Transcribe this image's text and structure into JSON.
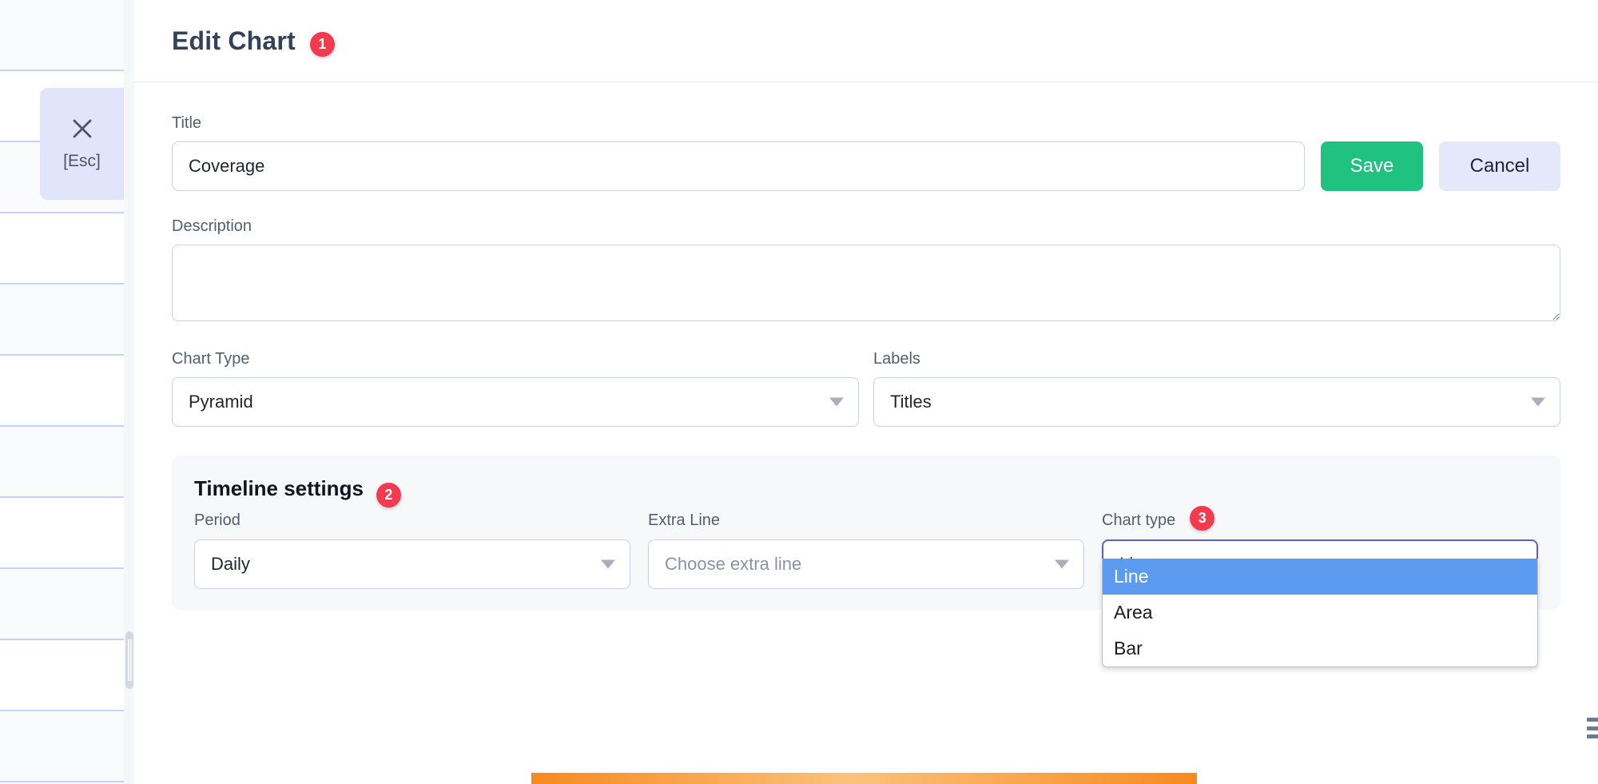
{
  "close_button": {
    "icon": "close-icon",
    "label": "[Esc]"
  },
  "modal": {
    "title": "Edit Chart",
    "badge_1": "1"
  },
  "form": {
    "title_label": "Title",
    "title_value": "Coverage",
    "description_label": "Description",
    "description_value": "",
    "description_placeholder": "",
    "chart_type_label": "Chart Type",
    "chart_type_value": "Pyramid",
    "labels_label": "Labels",
    "labels_value": "Titles"
  },
  "actions": {
    "save_label": "Save",
    "cancel_label": "Cancel"
  },
  "timeline": {
    "heading": "Timeline settings",
    "badge_2": "2",
    "period_label": "Period",
    "period_value": "Daily",
    "extra_line_label": "Extra Line",
    "extra_line_placeholder": "Choose extra line",
    "chart_type_label": "Chart type",
    "badge_3": "3",
    "chart_type_value": "Line",
    "chart_type_options": [
      "Line",
      "Area",
      "Bar"
    ],
    "chart_type_selected_index": 0
  },
  "colors": {
    "accent_save": "#20c27f",
    "badge_red": "#f43a4e",
    "focus_purple": "#5b5be6",
    "dropdown_highlight": "#5b9bf0",
    "cancel_lavender": "#e4e8fa",
    "panel_grey": "#f6f8fa",
    "orange_bar": "#f78a1e"
  }
}
